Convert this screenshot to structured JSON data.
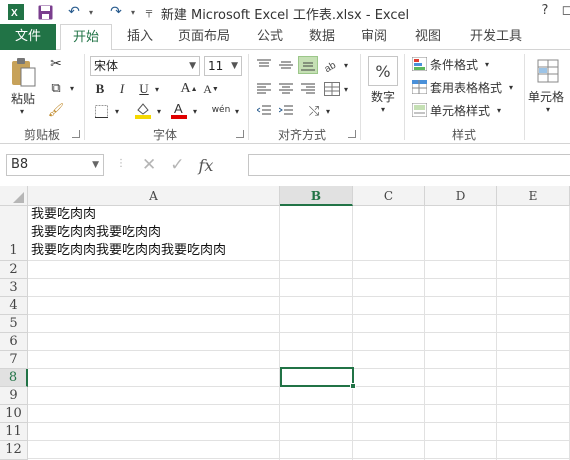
{
  "title": "新建 Microsoft Excel 工作表.xlsx - Excel",
  "window_controls": {
    "help": "?",
    "restore": "◻"
  },
  "tabs": [
    "文件",
    "开始",
    "插入",
    "页面布局",
    "公式",
    "数据",
    "审阅",
    "视图",
    "开发工具"
  ],
  "active_tab": "开始",
  "ribbon": {
    "clipboard": {
      "label": "剪贴板",
      "paste": "粘贴"
    },
    "font": {
      "label": "字体",
      "name": "宋体",
      "size": "11",
      "bold": "B",
      "italic": "I",
      "underline": "U",
      "grow": "A",
      "shrink": "A",
      "phonetic": "wén"
    },
    "alignment": {
      "label": "对齐方式"
    },
    "number": {
      "label": "数字",
      "percent": "%"
    },
    "styles": {
      "label": "样式",
      "conditional": "条件格式",
      "table": "套用表格格式",
      "cell": "单元格样式"
    },
    "cells": {
      "label": "单元格"
    }
  },
  "name_box": "B8",
  "formula_value": "",
  "columns": [
    "A",
    "B",
    "C",
    "D",
    "E"
  ],
  "selected_column": "B",
  "rows": [
    "1",
    "2",
    "3",
    "4",
    "5",
    "6",
    "7",
    "8",
    "9",
    "10",
    "11",
    "12"
  ],
  "selected_row": "8",
  "cell_a1": "我要吃肉肉\n我要吃肉肉我要吃肉肉\n我要吃肉肉我要吃肉肉我要吃肉肉",
  "colors": {
    "accent": "#217346",
    "font_color": "#e00000",
    "fill_color": "#f5d800"
  }
}
